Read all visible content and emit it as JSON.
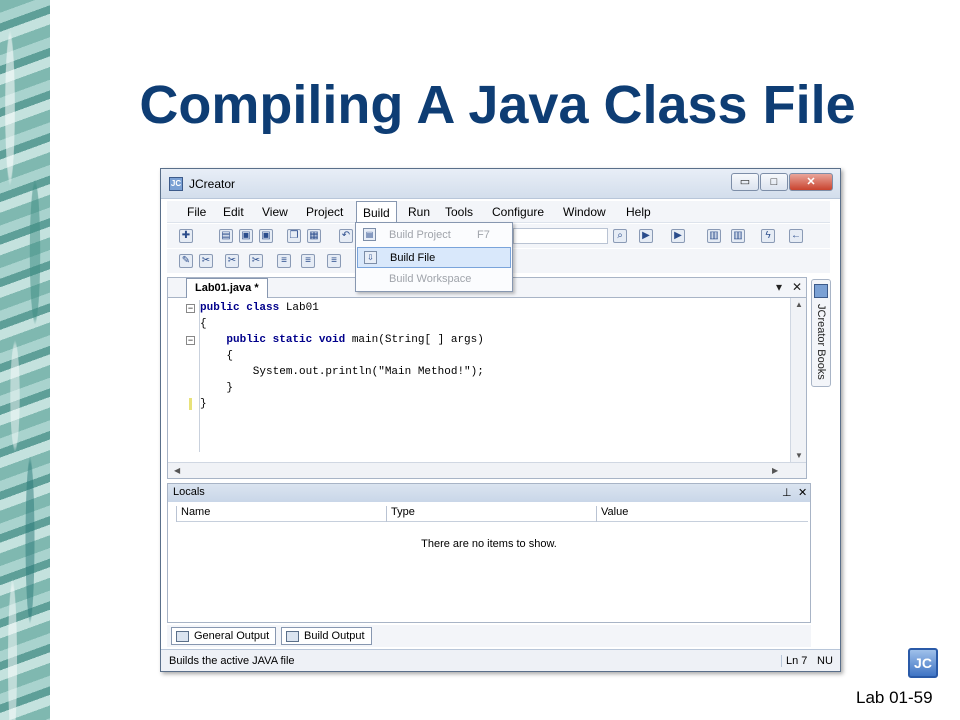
{
  "slide": {
    "title": "Compiling A Java Class File",
    "footer_label": "Lab 01-59",
    "logo_text": "JC"
  },
  "window": {
    "title": "JCreator",
    "controls": {
      "minimize": "▭",
      "maximize": "□",
      "close": "✕"
    }
  },
  "menubar": {
    "items": [
      "File",
      "Edit",
      "View",
      "Project",
      "Build",
      "Run",
      "Tools",
      "Configure",
      "Window",
      "Help"
    ],
    "active": "Build"
  },
  "build_menu": {
    "items": [
      {
        "label": "Build Project",
        "shortcut": "F7",
        "state": "disabled"
      },
      {
        "label": "Build File",
        "shortcut": "",
        "state": "highlighted"
      },
      {
        "label": "Build Workspace",
        "shortcut": "",
        "state": "disabled"
      }
    ]
  },
  "editor": {
    "tab_label": "Lab01.java *",
    "code_lines": [
      {
        "kw": "public class",
        "rest": " Lab01"
      },
      {
        "kw": "",
        "rest": "{"
      },
      {
        "kw": "    public static void",
        "rest": " main(String[ ] args)"
      },
      {
        "kw": "",
        "rest": "    {"
      },
      {
        "kw": "",
        "rest": "        System.out.println(\"Main Method!\");"
      },
      {
        "kw": "",
        "rest": "    }"
      },
      {
        "kw": "",
        "rest": "}"
      }
    ]
  },
  "side_panel": {
    "label": "JCreator Books"
  },
  "locals": {
    "title": "Locals",
    "columns": [
      "Name",
      "Type",
      "Value"
    ],
    "empty_message": "There are no items to show."
  },
  "output_tabs": [
    "General Output",
    "Build Output"
  ],
  "statusbar": {
    "message": "Builds the active JAVA file",
    "line": "Ln 7",
    "mode": "NU"
  },
  "icons": {
    "app": "jcreator-app-icon",
    "pin": "pin-icon",
    "close": "close-icon"
  },
  "colors": {
    "title": "#0e3d74",
    "keyword": "#00008b",
    "highlight": "#d9e8fb"
  }
}
